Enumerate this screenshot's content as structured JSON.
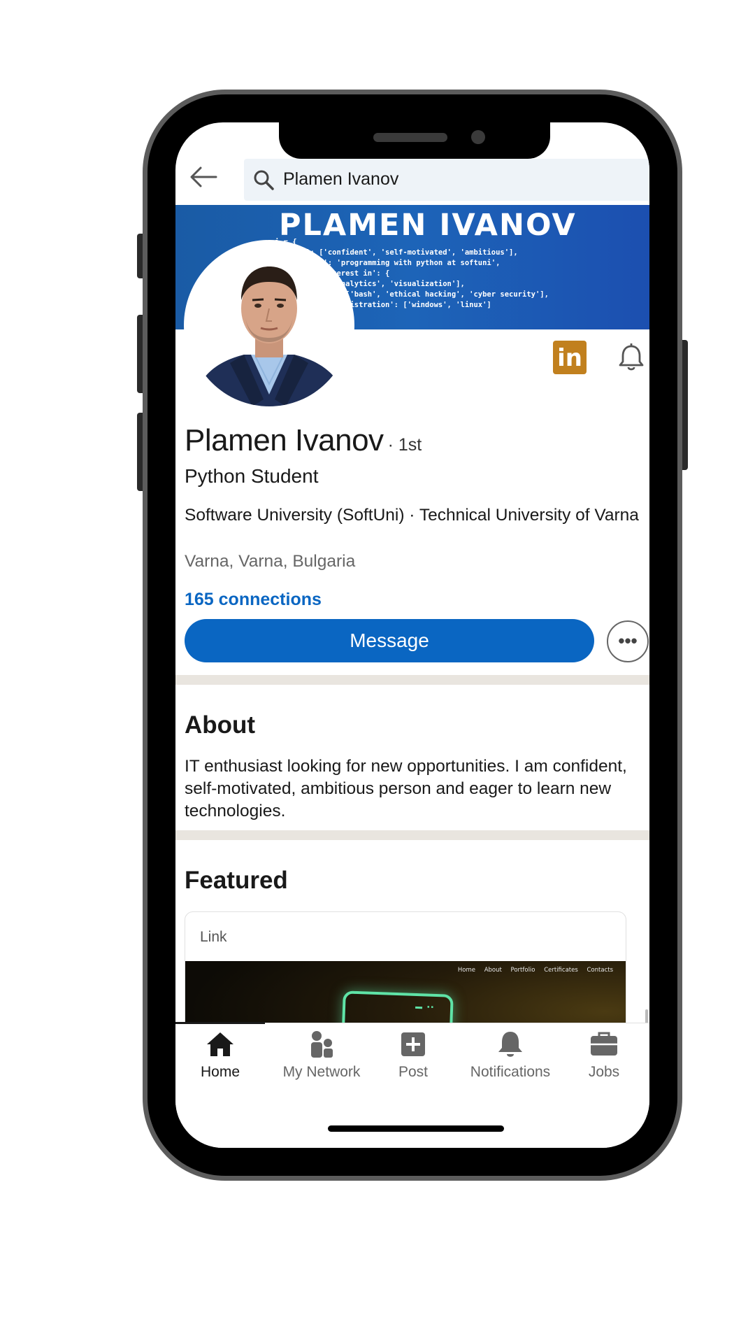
{
  "search": {
    "query": "Plamen Ivanov"
  },
  "banner": {
    "title": "PLAMEN IVANOV",
    "code": "i = {\n  'I am': ['confident', 'self-motivated', 'ambitious'],\n  'learning': 'programming with python at softuni',\n  'area of interest in': {\n    'data': ['analytics', 'visualization'],\n    'security': ['bash', 'ethical hacking', 'cyber security'],\n    'system administration': ['windows', 'linux']"
  },
  "profile": {
    "name": "Plamen Ivanov",
    "degree": "· 1st",
    "headline": "Python Student",
    "education": "Software University (SoftUni) · Technical University of Varna",
    "location": "Varna, Varna, Bulgaria",
    "connections": "165 connections",
    "message_label": "Message",
    "more_label": "•••"
  },
  "about": {
    "title": "About",
    "text": "IT enthusiast looking for new opportunities. I am confident, self-motivated, ambitious person and eager to learn new technologies."
  },
  "featured": {
    "title": "Featured",
    "card_label": "Link",
    "site_nav": [
      "Home",
      "About",
      "Portfolio",
      "Certificates",
      "Contacts"
    ]
  },
  "tabs": [
    {
      "label": "Home",
      "icon": "home-icon",
      "active": true
    },
    {
      "label": "My Network",
      "icon": "network-icon",
      "active": false
    },
    {
      "label": "Post",
      "icon": "post-icon",
      "active": false
    },
    {
      "label": "Notifications",
      "icon": "bell-icon",
      "active": false
    },
    {
      "label": "Jobs",
      "icon": "briefcase-icon",
      "active": false
    }
  ],
  "colors": {
    "accent": "#0a66c2",
    "banner": "#1d64b8",
    "linkedin_badge": "#c1801e",
    "divider": "#e9e5df"
  }
}
